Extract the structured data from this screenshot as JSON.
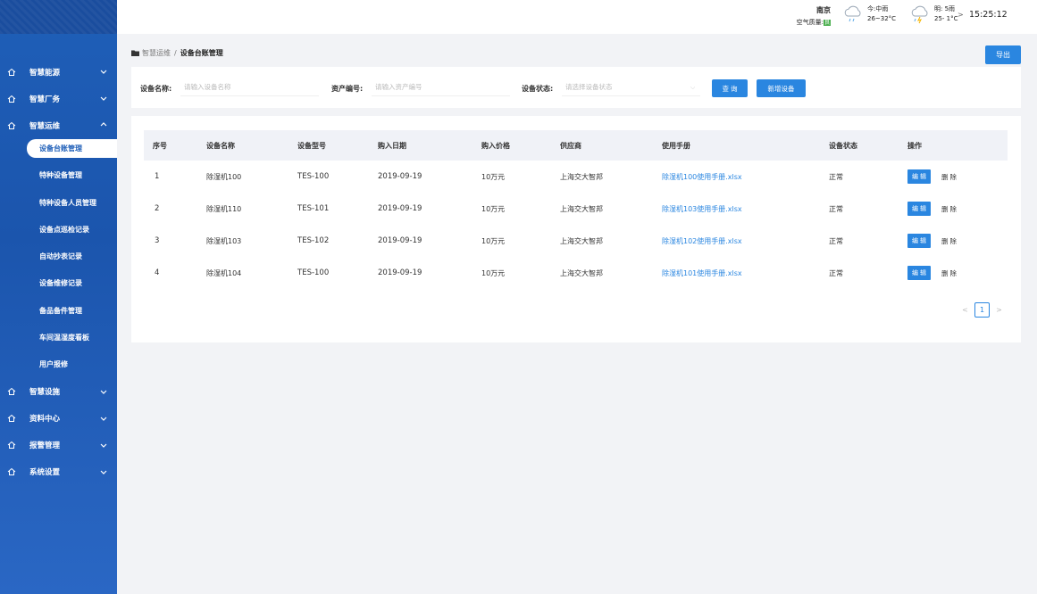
{
  "header": {
    "city": "南京",
    "air_quality_label": "空气质量:",
    "air_quality_value": "良",
    "weather_today_line1": "今:中雨",
    "weather_today_line2": "26~32°C",
    "weather_tomorrow_line1": "明: 5雨",
    "weather_tomorrow_line2": "25- 1°C",
    "clock": "15:25:12"
  },
  "sidebar": {
    "groups_before": [
      {
        "label": "智慧能源"
      },
      {
        "label": "智慧厂务"
      },
      {
        "label": "智慧运维"
      }
    ],
    "sub_items": [
      {
        "label": "设备台账管理"
      },
      {
        "label": "特种设备管理"
      },
      {
        "label": "特种设备人员管理"
      },
      {
        "label": "设备点巡检记录"
      },
      {
        "label": "自动抄表记录"
      },
      {
        "label": "设备维修记录"
      },
      {
        "label": "备品备件管理"
      },
      {
        "label": "车间温湿度看板"
      },
      {
        "label": "用户报修"
      }
    ],
    "groups_after": [
      {
        "label": "智慧设施"
      },
      {
        "label": "资料中心"
      },
      {
        "label": "报警管理"
      },
      {
        "label": "系统设置"
      }
    ]
  },
  "breadcrumb": {
    "first": "智慧运维",
    "separator": "/",
    "current": "设备台账管理"
  },
  "export_label": "导出",
  "filter": {
    "name_label": "设备名称:",
    "name_placeholder": "请输入设备名称",
    "asset_label": "资产编号:",
    "asset_placeholder": "请输入资产编号",
    "status_label": "设备状态:",
    "status_placeholder": "请选择设备状态",
    "query_label": "查 询",
    "add_label": "新增设备"
  },
  "table": {
    "columns": [
      "序号",
      "设备名称",
      "设备型号",
      "购入日期",
      "购入价格",
      "供应商",
      "使用手册",
      "设备状态",
      "操作"
    ],
    "rows": [
      {
        "no": "1",
        "name": "除湿机100",
        "model": "TES-100",
        "date": "2019-09-19",
        "price": "10万元",
        "supplier": "上海交大智邦",
        "manual": "除湿机100使用手册.xlsx",
        "status": "正常",
        "edit": "编 辑",
        "del": "删 除"
      },
      {
        "no": "2",
        "name": "除湿机110",
        "model": "TES-101",
        "date": "2019-09-19",
        "price": "10万元",
        "supplier": "上海交大智邦",
        "manual": "除湿机103使用手册.xlsx",
        "status": "正常",
        "edit": "编 辑",
        "del": "删 除"
      },
      {
        "no": "3",
        "name": "除湿机103",
        "model": "TES-102",
        "date": "2019-09-19",
        "price": "10万元",
        "supplier": "上海交大智邦",
        "manual": "除湿机102使用手册.xlsx",
        "status": "正常",
        "edit": "编 辑",
        "del": "删 除"
      },
      {
        "no": "4",
        "name": "除湿机104",
        "model": "TES-100",
        "date": "2019-09-19",
        "price": "10万元",
        "supplier": "上海交大智邦",
        "manual": "除湿机101使用手册.xlsx",
        "status": "正常",
        "edit": "编 辑",
        "del": "删 除"
      }
    ]
  },
  "pagination": {
    "prev": "<",
    "current": "1",
    "next": ">"
  },
  "colors": {
    "primary": "#2a86e0",
    "sidebar": "#1f5fb8"
  }
}
